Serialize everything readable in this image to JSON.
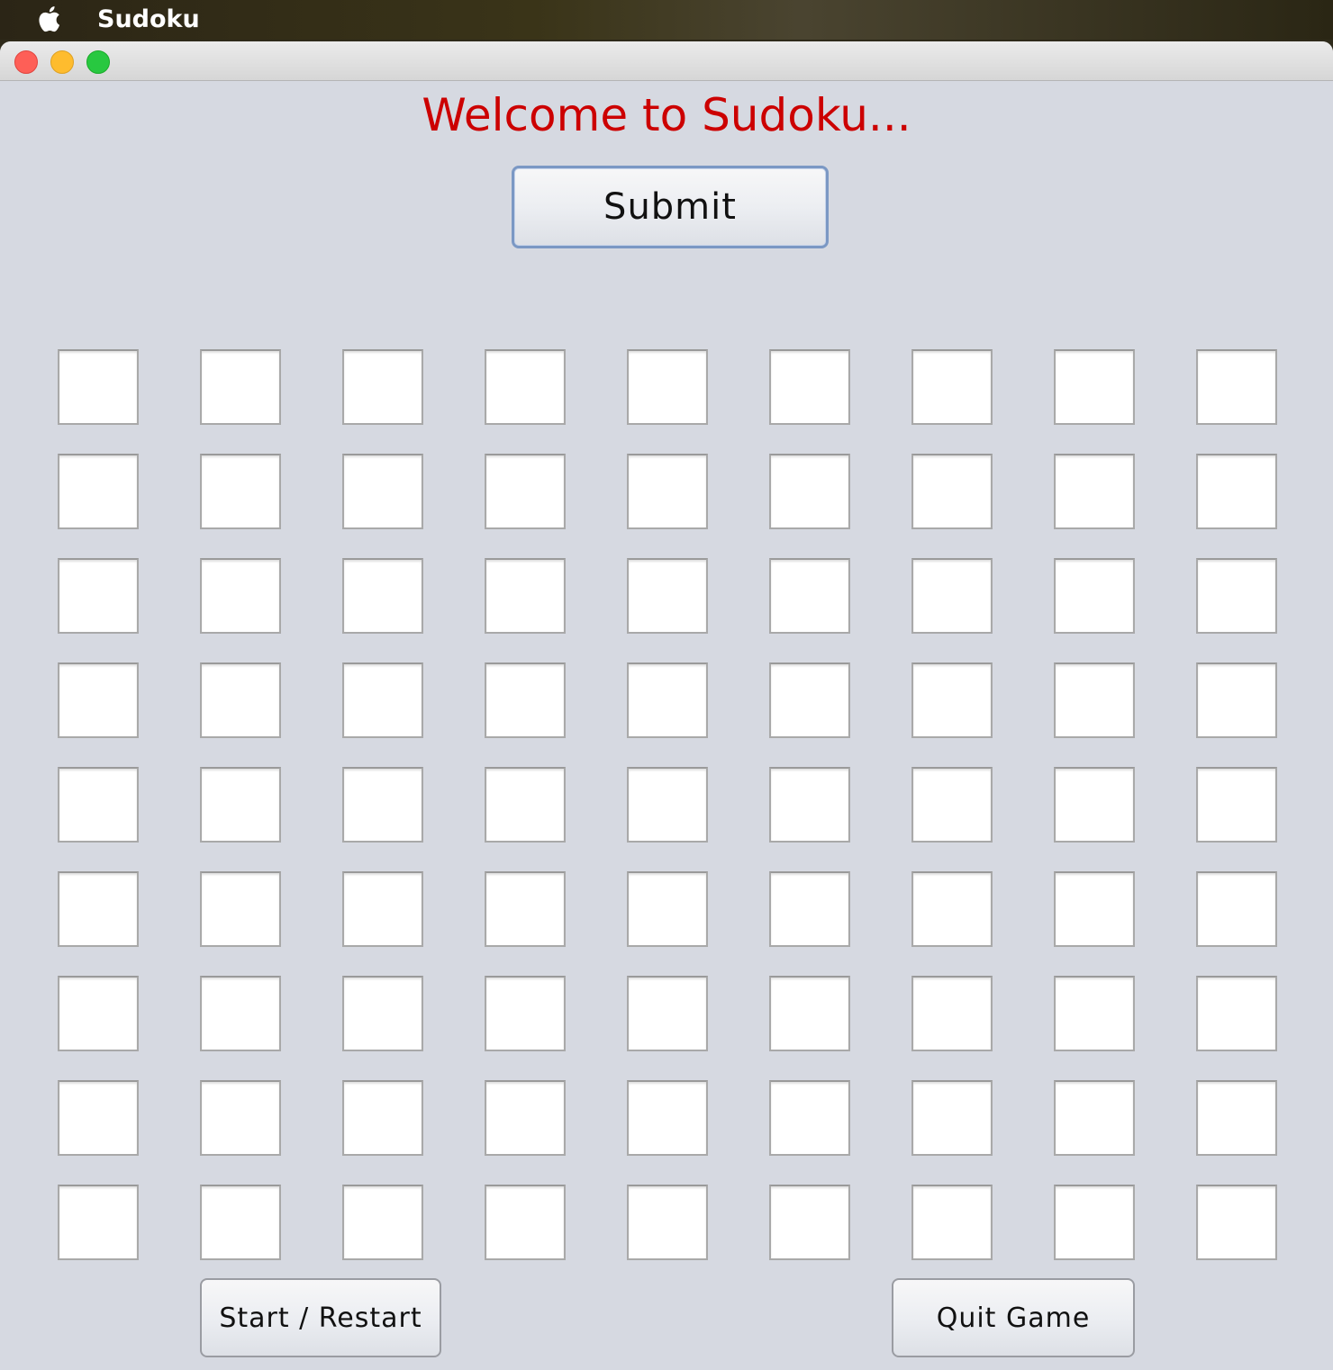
{
  "menubar": {
    "app_name": "Sudoku"
  },
  "window": {
    "welcome_text": "Welcome to Sudoku...",
    "submit_label": "Submit",
    "start_restart_label": "Start / Restart",
    "quit_label": "Quit Game"
  },
  "board": {
    "rows": 9,
    "cols": 9,
    "values": [
      [
        "",
        "",
        "",
        "",
        "",
        "",
        "",
        "",
        ""
      ],
      [
        "",
        "",
        "",
        "",
        "",
        "",
        "",
        "",
        ""
      ],
      [
        "",
        "",
        "",
        "",
        "",
        "",
        "",
        "",
        ""
      ],
      [
        "",
        "",
        "",
        "",
        "",
        "",
        "",
        "",
        ""
      ],
      [
        "",
        "",
        "",
        "",
        "",
        "",
        "",
        "",
        ""
      ],
      [
        "",
        "",
        "",
        "",
        "",
        "",
        "",
        "",
        ""
      ],
      [
        "",
        "",
        "",
        "",
        "",
        "",
        "",
        "",
        ""
      ],
      [
        "",
        "",
        "",
        "",
        "",
        "",
        "",
        "",
        ""
      ],
      [
        "",
        "",
        "",
        "",
        "",
        "",
        "",
        "",
        ""
      ]
    ]
  },
  "colors": {
    "welcome_text": "#cc0000",
    "window_background": "#d6d9e1",
    "submit_border": "#7b98c4"
  },
  "icons": {
    "apple": "apple-icon",
    "close": "close-icon",
    "minimize": "minimize-icon",
    "zoom": "zoom-icon"
  }
}
